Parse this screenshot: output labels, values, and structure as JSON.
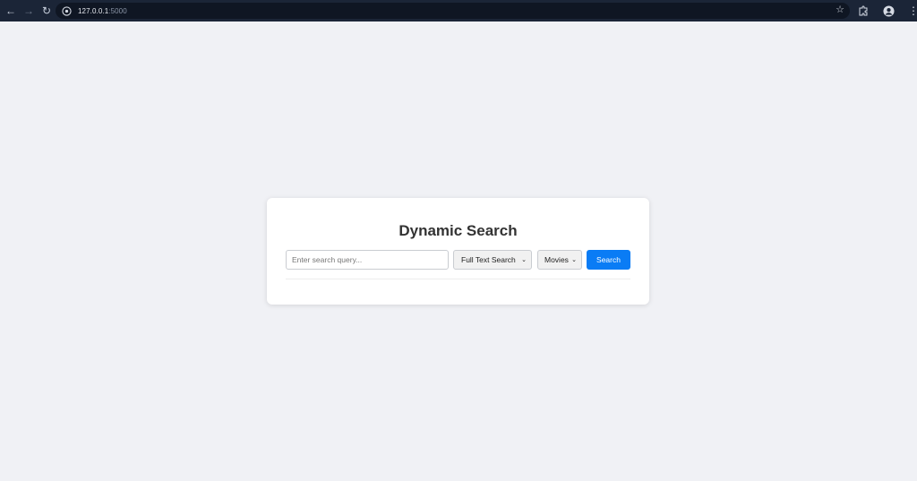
{
  "browser": {
    "url_host": "127.0.0.1",
    "url_port": ":5000",
    "nav": {
      "back_icon": "arrow-left-icon",
      "forward_icon": "arrow-right-icon",
      "reload_icon": "reload-icon"
    }
  },
  "search_card": {
    "title": "Dynamic Search",
    "input_placeholder": "Enter search query...",
    "input_value": "",
    "search_type_selected": "Full Text Search",
    "category_selected": "Movies",
    "search_button_label": "Search"
  },
  "colors": {
    "page_background": "#f0f1f5",
    "browser_bar": "#1b2537",
    "accent": "#0a7cf5",
    "title_text": "#333333"
  }
}
